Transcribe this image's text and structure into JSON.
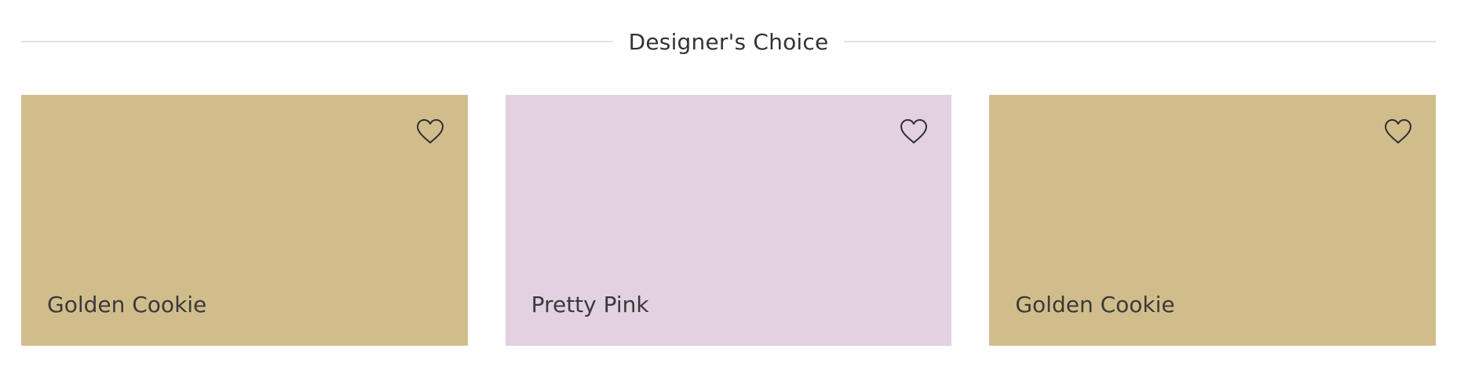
{
  "section": {
    "title": "Designer's Choice"
  },
  "cards": [
    {
      "name": "Golden Cookie",
      "color": "#d1bd8c",
      "favorite_icon": "heart-outline-icon"
    },
    {
      "name": "Pretty Pink",
      "color": "#e3d1e1",
      "favorite_icon": "heart-outline-icon"
    },
    {
      "name": "Golden Cookie",
      "color": "#d1bd8c",
      "favorite_icon": "heart-outline-icon"
    }
  ]
}
